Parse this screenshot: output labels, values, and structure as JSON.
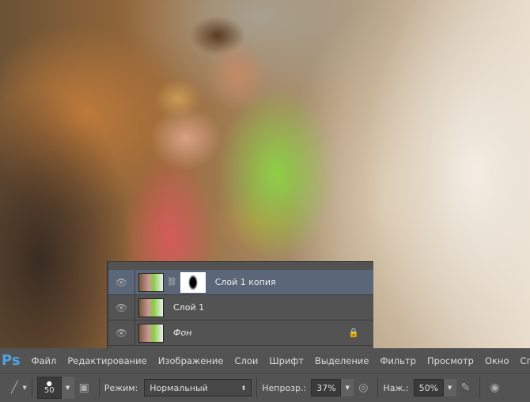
{
  "layers": [
    {
      "name": "Слой 1 копия",
      "selected": true,
      "has_mask": true,
      "visible": true
    },
    {
      "name": "Слой 1",
      "selected": false,
      "visible": true
    },
    {
      "name": "Фон",
      "selected": false,
      "visible": true,
      "locked": true,
      "italic": true
    }
  ],
  "menubar": {
    "logo": "Ps",
    "items": [
      "Файл",
      "Редактирование",
      "Изображение",
      "Слои",
      "Шрифт",
      "Выделение",
      "Фильтр",
      "Просмотр",
      "Окно",
      "Спр"
    ]
  },
  "toolbar": {
    "brush_size": "50",
    "mode_label": "Режим:",
    "mode_value": "Нормальный",
    "opacity_label": "Непрозр.:",
    "opacity_value": "37%",
    "pressure_label": "Наж.:",
    "pressure_value": "50%"
  }
}
